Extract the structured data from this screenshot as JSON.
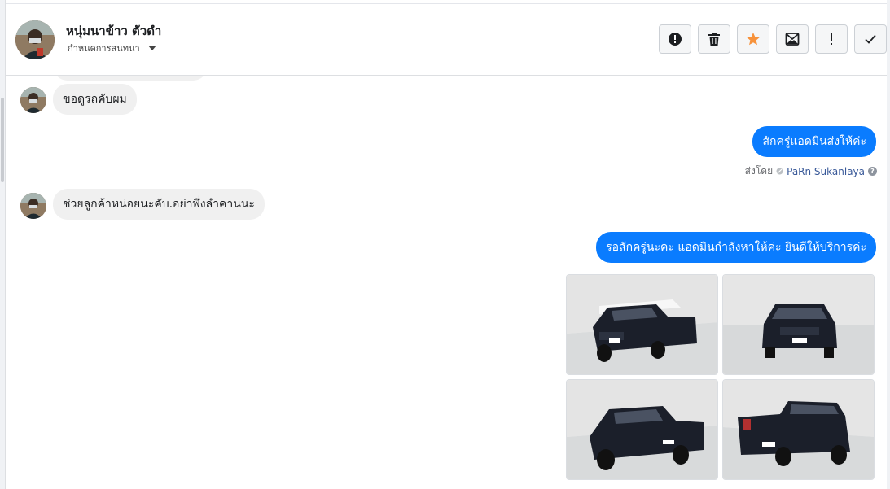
{
  "header": {
    "contact_name": "หนุ่มนาข้าว ตัวดำ",
    "settings_label": "กำหนดการสนทนา"
  },
  "toolbar": {
    "buttons": [
      {
        "icon": "alert-circle-icon"
      },
      {
        "icon": "trash-icon"
      },
      {
        "icon": "star-icon",
        "color": "#f7923b"
      },
      {
        "icon": "mark-unread-icon"
      },
      {
        "icon": "exclamation-icon"
      },
      {
        "icon": "checkmark-icon"
      }
    ]
  },
  "messages": [
    {
      "direction": "incoming",
      "text": "ขอดูรถคับผม"
    },
    {
      "direction": "outgoing",
      "text": "สักครู่แอดมินส่งให้ค่ะ"
    },
    {
      "direction": "incoming",
      "text": "ช่วยลูกค้าหน่อยนะคับ.อย่าพึ่งลำคานนะ"
    },
    {
      "direction": "outgoing",
      "text": "รอสักครู่นะคะ แอดมินกำลังหาให้ค่ะ ยินดีให้บริการค่ะ"
    }
  ],
  "sent_by": {
    "prefix": "ส่งโดย",
    "agent": "PaRn Sukanlaya",
    "help": "?"
  },
  "photos": [
    {
      "alt": "pickup-front-left"
    },
    {
      "alt": "pickup-front"
    },
    {
      "alt": "pickup-front-left-wide"
    },
    {
      "alt": "pickup-rear-left"
    }
  ],
  "colors": {
    "outgoing_bubble": "#0a7cff",
    "incoming_bubble": "#f0f0f0",
    "agent_link": "#385898"
  }
}
